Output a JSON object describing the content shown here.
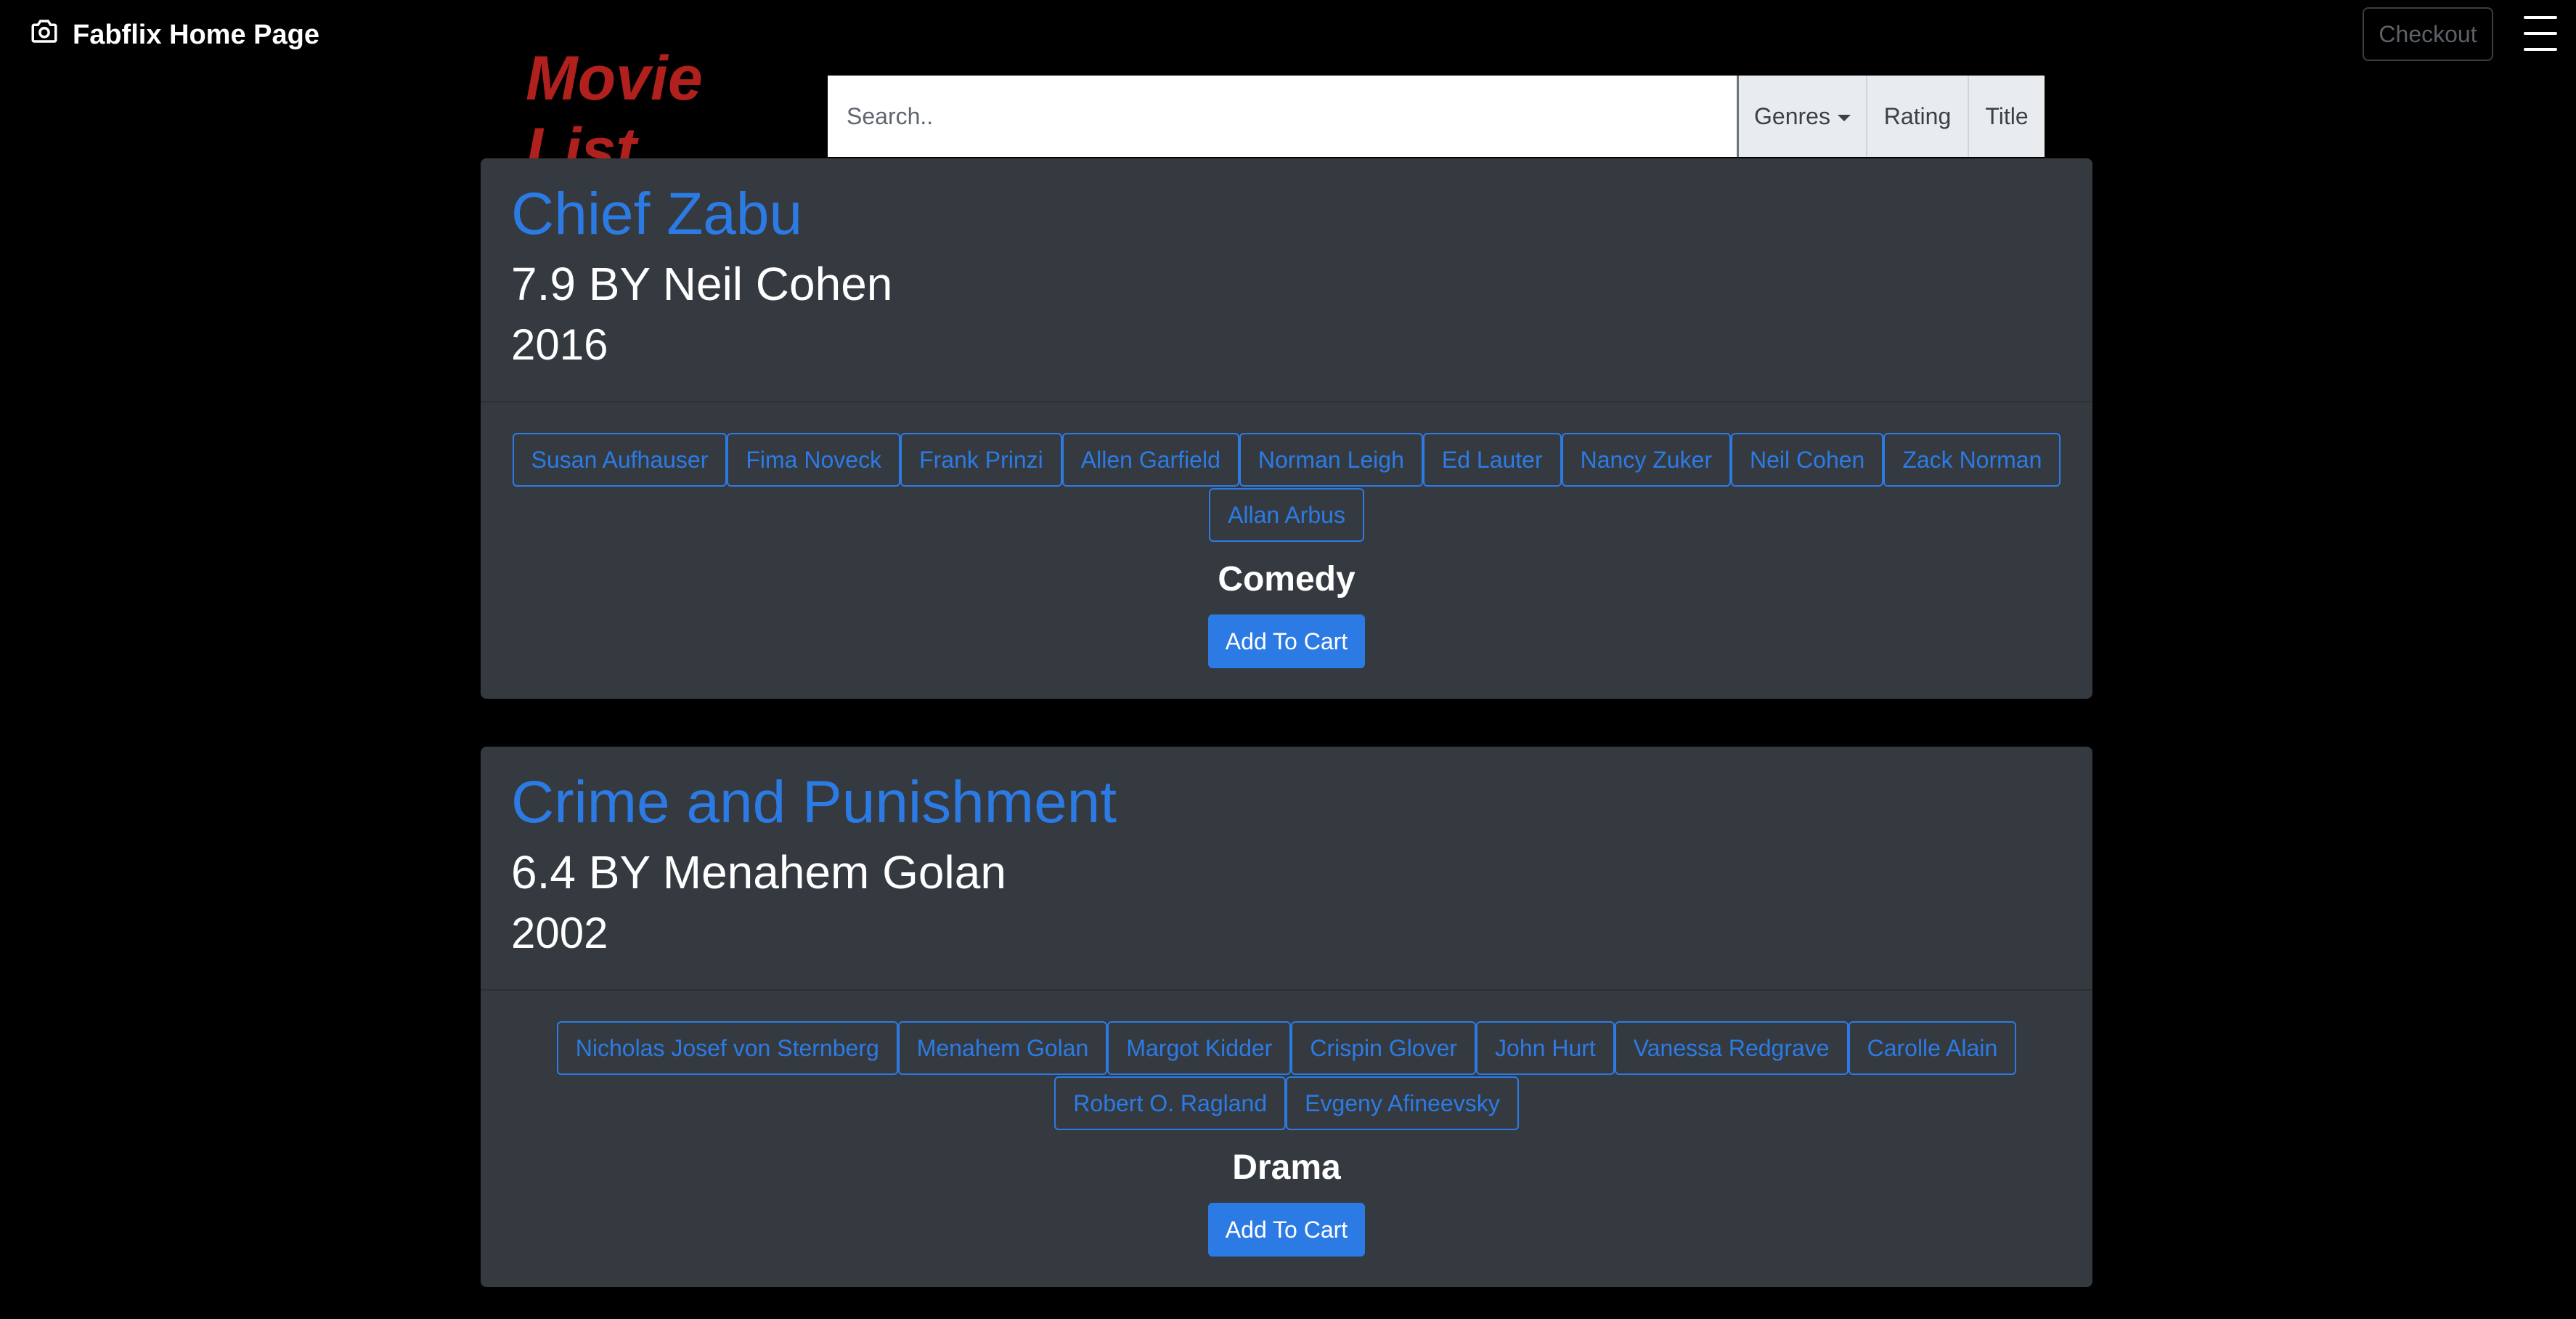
{
  "navbar": {
    "brand_label": "Fabflix Home Page",
    "brand_icon": "camera-icon",
    "checkout_label": "Checkout",
    "menu_icon": "hamburger-menu-icon"
  },
  "header": {
    "list_title": "Movie List",
    "search_placeholder": "Search..",
    "genres_label": "Genres",
    "rating_label": "Rating",
    "title_label": "Title"
  },
  "colors": {
    "accent": "#2c7be5",
    "list_title": "#b0201d",
    "card_bg": "#343a40",
    "page_bg": "#000000"
  },
  "movies": [
    {
      "title": "Chief Zabu",
      "rating_line": "7.9 BY Neil Cohen",
      "year": "2016",
      "star_rows": [
        [
          "Susan Aufhauser",
          "Fima Noveck",
          "Frank Prinzi",
          "Allen Garfield",
          "Norman Leigh",
          "Ed Lauter",
          "Nancy Zuker",
          "Neil Cohen",
          "Zack Norman"
        ],
        [
          "Allan Arbus"
        ]
      ],
      "genre": "Comedy",
      "cart_label": "Add To Cart"
    },
    {
      "title": "Crime and Punishment",
      "rating_line": "6.4 BY Menahem Golan",
      "year": "2002",
      "star_rows": [
        [
          "Nicholas Josef von Sternberg",
          "Menahem Golan",
          "Margot Kidder",
          "Crispin Glover",
          "John Hurt",
          "Vanessa Redgrave",
          "Carolle Alain"
        ],
        [
          "Robert O. Ragland",
          "Evgeny Afineevsky"
        ]
      ],
      "genre": "Drama",
      "cart_label": "Add To Cart"
    }
  ]
}
